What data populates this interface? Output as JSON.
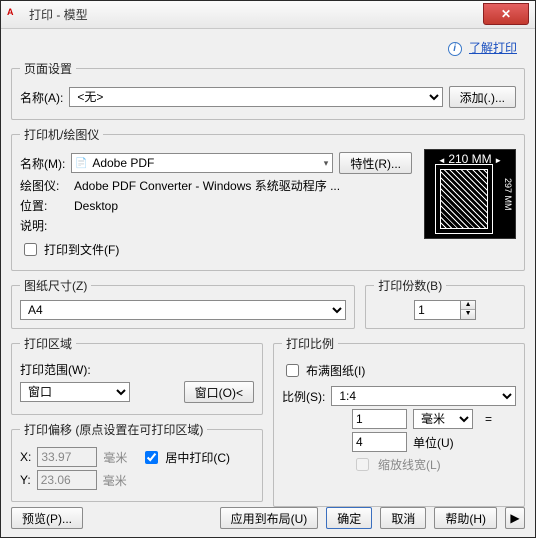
{
  "title": "打印 - 模型",
  "learn": {
    "label": "了解打印"
  },
  "pageSetup": {
    "legend": "页面设置",
    "nameLabel": "名称(A):",
    "nameValue": "<无>",
    "addLabel": "添加(.)..."
  },
  "printer": {
    "legend": "打印机/绘图仪",
    "nameLabel": "名称(M):",
    "nameValue": "Adobe PDF",
    "propsLabel": "特性(R)...",
    "plotterLabel": "绘图仪:",
    "plotterValue": "Adobe PDF Converter - Windows 系统驱动程序 ...",
    "locationLabel": "位置:",
    "locationValue": "Desktop",
    "descLabel": "说明:",
    "toFileLabel": "打印到文件(F)",
    "preview": {
      "width": "210 MM",
      "height": "297 MM"
    }
  },
  "paper": {
    "legend": "图纸尺寸(Z)",
    "value": "A4"
  },
  "copies": {
    "legend": "打印份数(B)",
    "value": "1"
  },
  "area": {
    "legend": "打印区域",
    "rangeLabel": "打印范围(W):",
    "rangeValue": "窗口",
    "windowBtn": "窗口(O)<"
  },
  "offset": {
    "legend": "打印偏移 (原点设置在可打印区域)",
    "xLabel": "X:",
    "xValue": "33.97",
    "xUnit": "毫米",
    "yLabel": "Y:",
    "yValue": "23.06",
    "yUnit": "毫米",
    "centerLabel": "居中打印(C)"
  },
  "scale": {
    "legend": "打印比例",
    "fitLabel": "布满图纸(I)",
    "scaleLabel": "比例(S):",
    "scaleValue": "1:4",
    "val1": "1",
    "unit1": "毫米",
    "val2": "4",
    "unit2Label": "单位(U)",
    "scaleLWLabel": "缩放线宽(L)"
  },
  "footer": {
    "preview": "预览(P)...",
    "applyLayout": "应用到布局(U)",
    "ok": "确定",
    "cancel": "取消",
    "help": "帮助(H)"
  }
}
